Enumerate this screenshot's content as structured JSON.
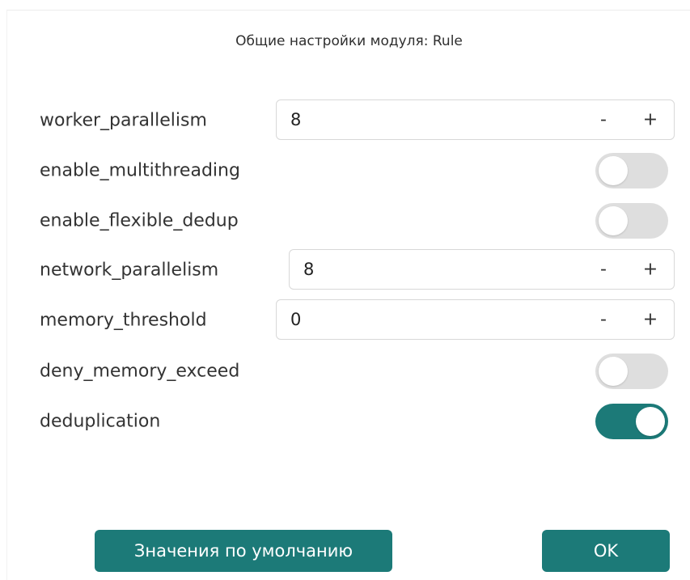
{
  "dialog": {
    "title": "Общие настройки модуля: Rule"
  },
  "settings": {
    "worker_parallelism": {
      "label": "worker_parallelism",
      "value": "8",
      "minus": "-",
      "plus": "+"
    },
    "enable_multithreading": {
      "label": "enable_multithreading",
      "checked": false
    },
    "enable_flexible_dedup": {
      "label": "enable_flexible_dedup",
      "checked": false
    },
    "network_parallelism": {
      "label": "network_parallelism",
      "value": "8",
      "minus": "-",
      "plus": "+"
    },
    "memory_threshold": {
      "label": "memory_threshold",
      "value": "0",
      "minus": "-",
      "plus": "+"
    },
    "deny_memory_exceed": {
      "label": "deny_memory_exceed",
      "checked": false
    },
    "deduplication": {
      "label": "deduplication",
      "checked": true
    }
  },
  "buttons": {
    "defaults_label": "Значения по умолчанию",
    "ok_label": "OK"
  },
  "colors": {
    "accent": "#1c7a78",
    "toggle_off": "#dedede",
    "border": "#d8d8d8"
  }
}
